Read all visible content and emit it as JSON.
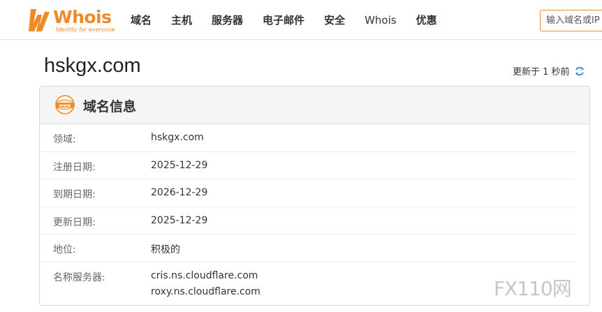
{
  "header": {
    "brand": "Whois",
    "tagline": "Identity for everyone",
    "nav": [
      "域名",
      "主机",
      "服务器",
      "电子邮件",
      "安全",
      "Whois",
      "优惠"
    ],
    "search_placeholder": "输入域名或IP"
  },
  "domain": {
    "name": "hskgx.com",
    "updated": "更新于 1 秒前"
  },
  "card": {
    "title": "域名信息",
    "rows": [
      {
        "label": "领域:",
        "value": "hskgx.com"
      },
      {
        "label": "注册日期:",
        "value": "2025-12-29"
      },
      {
        "label": "到期日期:",
        "value": "2026-12-29"
      },
      {
        "label": "更新日期:",
        "value": "2025-12-29"
      },
      {
        "label": "地位:",
        "value": "积极的"
      }
    ],
    "nameservers_label": "名称服务器:",
    "nameservers": [
      "cris.ns.cloudflare.com",
      "roxy.ns.cloudflare.com"
    ]
  },
  "watermark": "FX110网",
  "colors": {
    "accent": "#f08a24",
    "refresh": "#2f86d8"
  }
}
